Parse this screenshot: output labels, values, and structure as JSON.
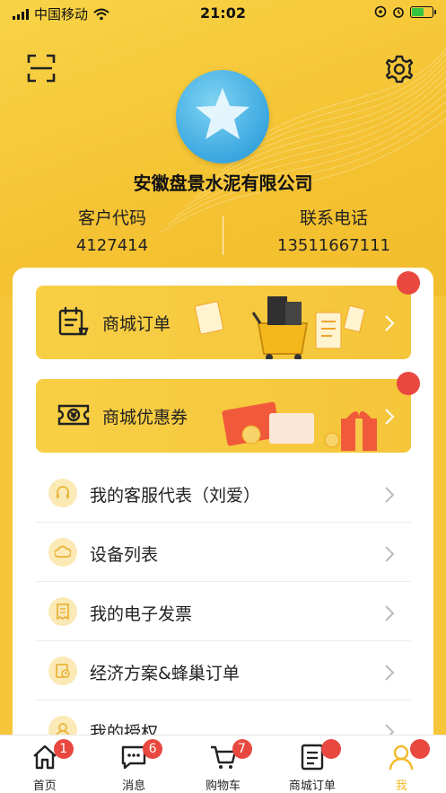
{
  "status_bar": {
    "carrier": "中国移动",
    "time": "21:02"
  },
  "header": {
    "scan_icon": "scan-icon",
    "settings_icon": "gear-icon",
    "company_name": "安徽盘景水泥有限公司",
    "customer_code_label": "客户代码",
    "customer_code": "4127414",
    "phone_label": "联系电话",
    "phone": "13511667111"
  },
  "banners": [
    {
      "label": "商城订单",
      "icon": "order-calendar-icon",
      "has_dot": true
    },
    {
      "label": "商城优惠券",
      "icon": "coupon-ticket-icon",
      "has_dot": true
    }
  ],
  "menu": [
    {
      "label": "我的客服代表（刘爱）",
      "icon": "headset-icon"
    },
    {
      "label": "设备列表",
      "icon": "cloud-icon"
    },
    {
      "label": "我的电子发票",
      "icon": "receipt-icon"
    },
    {
      "label": "经济方案&蜂巢订单",
      "icon": "document-clock-icon"
    },
    {
      "label": "我的授权",
      "icon": "user-icon"
    }
  ],
  "tabbar": [
    {
      "label": "首页",
      "icon": "home-icon",
      "badge": "1"
    },
    {
      "label": "消息",
      "icon": "message-icon",
      "badge": "6"
    },
    {
      "label": "购物车",
      "icon": "cart-icon",
      "badge": "7"
    },
    {
      "label": "商城订单",
      "icon": "order-list-icon",
      "badge": ""
    },
    {
      "label": "我",
      "icon": "user-icon",
      "badge": ""
    }
  ],
  "colors": {
    "brand_yellow": "#f5c53a",
    "active_tab": "#f2b92a",
    "badge_red": "#e8483f"
  }
}
